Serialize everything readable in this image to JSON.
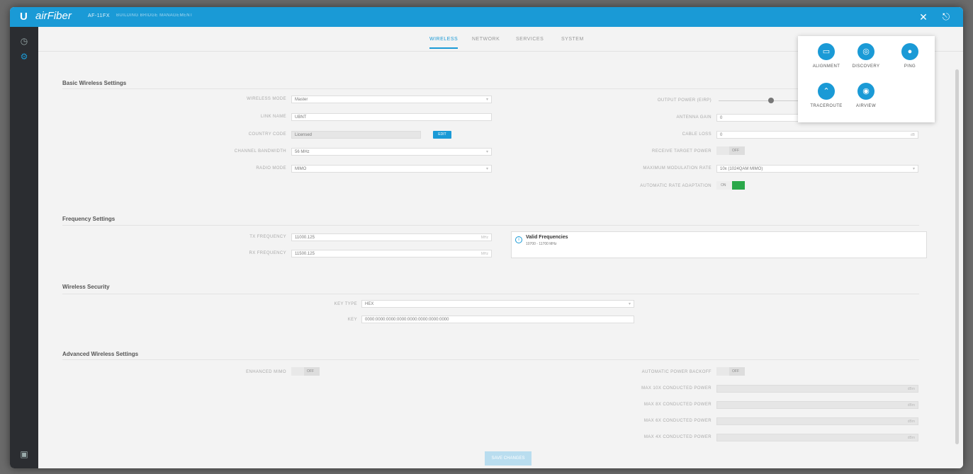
{
  "topbar": {
    "logo": "U",
    "brand": "airFiber",
    "model": "AF-11FX",
    "model_sub": "BUILDING BRIDGE MANAGEMENT",
    "tools_icon": "tools-icon",
    "logout_icon": "logout-icon"
  },
  "tabs": [
    "WIRELESS",
    "NETWORK",
    "SERVICES",
    "SYSTEM"
  ],
  "basic": {
    "title": "Basic Wireless Settings",
    "wireless_mode_label": "WIRELESS MODE",
    "wireless_mode": "Master",
    "link_name_label": "LINK NAME",
    "link_name": "UBNT",
    "country_code_label": "COUNTRY CODE",
    "country_code": "Licensed",
    "edit": "EDIT",
    "channel_bw_label": "CHANNEL BANDWIDTH",
    "channel_bw": "56 MHz",
    "radio_mode_label": "RADIO MODE",
    "radio_mode": "MIMO",
    "output_power_label": "OUTPUT POWER (EIRP)",
    "output_power_level": 0.62,
    "antenna_gain_label": "ANTENNA GAIN",
    "antenna_gain": "0",
    "cable_loss_label": "CABLE LOSS",
    "cable_loss": "0",
    "cable_loss_unit": "dB",
    "rx_target_label": "RECEIVE TARGET POWER",
    "rx_target": "OFF",
    "max_mod_label": "MAXIMUM MODULATION RATE",
    "max_mod": "10x (1024QAM MIMO)",
    "auto_rate_label": "AUTOMATIC RATE ADAPTATION",
    "auto_rate": "ON"
  },
  "frequency": {
    "title": "Frequency Settings",
    "tx_label": "TX FREQUENCY",
    "tx": "11000.125",
    "rx_label": "RX FREQUENCY",
    "rx": "11500.125",
    "unit": "MHz",
    "valid_title": "Valid Frequencies",
    "valid_range": "10700 - 11700 MHz"
  },
  "security": {
    "title": "Wireless Security",
    "key_type_label": "KEY TYPE",
    "key_type": "HEX",
    "key_label": "KEY",
    "key": "0000:0000:0000:0000:0000:0000:0000:0000"
  },
  "advanced": {
    "title": "Advanced Wireless Settings",
    "enhanced_mimo_label": "ENHANCED MIMO",
    "enhanced_mimo": "OFF",
    "auto_power_label": "AUTOMATIC POWER BACKOFF",
    "auto_power": "OFF",
    "max_10x_label": "MAX 10X CONDUCTED POWER",
    "max_8x_label": "MAX 8X CONDUCTED POWER",
    "max_6x_label": "MAX 6X CONDUCTED POWER",
    "max_4x_label": "MAX 4X CONDUCTED POWER",
    "unit": "dBm"
  },
  "save": "SAVE CHANGES",
  "tools": [
    {
      "label": "ALIGNMENT",
      "icon": "alignment-icon"
    },
    {
      "label": "DISCOVERY",
      "icon": "discovery-icon"
    },
    {
      "label": "PING",
      "icon": "ping-icon"
    },
    {
      "label": "TRACEROUTE",
      "icon": "traceroute-icon"
    },
    {
      "label": "AIRVIEW",
      "icon": "airview-icon"
    }
  ]
}
